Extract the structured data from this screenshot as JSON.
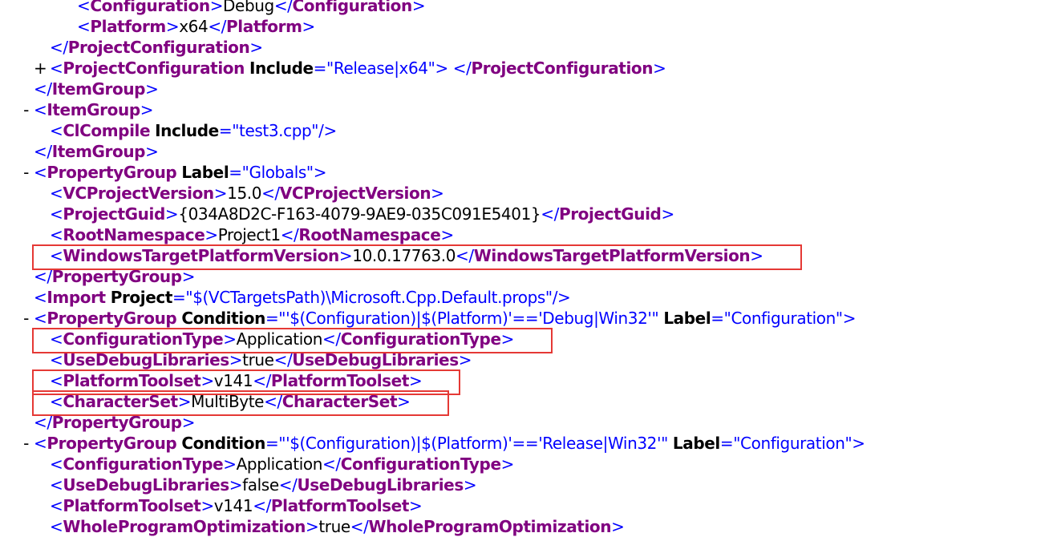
{
  "colors": {
    "tag": "#800080",
    "attr_name": "#000000",
    "attr_value": "#0000ff",
    "text": "#000000",
    "punct": "#0000ff",
    "highlight_border": "#e53935"
  },
  "lines": [
    {
      "toggle": "",
      "depth": 3,
      "tokens": [
        [
          "p",
          "<"
        ],
        [
          "t",
          "Configuration"
        ],
        [
          "p",
          ">"
        ],
        [
          "x",
          "Debug"
        ],
        [
          "p",
          "</"
        ],
        [
          "t",
          "Configuration"
        ],
        [
          "p",
          ">"
        ]
      ]
    },
    {
      "toggle": "",
      "depth": 3,
      "tokens": [
        [
          "p",
          "<"
        ],
        [
          "t",
          "Platform"
        ],
        [
          "p",
          ">"
        ],
        [
          "x",
          "x64"
        ],
        [
          "p",
          "</"
        ],
        [
          "t",
          "Platform"
        ],
        [
          "p",
          ">"
        ]
      ]
    },
    {
      "toggle": "",
      "depth": 2,
      "tokens": [
        [
          "p",
          "</"
        ],
        [
          "t",
          "ProjectConfiguration"
        ],
        [
          "p",
          ">"
        ]
      ]
    },
    {
      "toggle": "+",
      "depth": 2,
      "tokens": [
        [
          "p",
          "<"
        ],
        [
          "t",
          "ProjectConfiguration"
        ],
        [
          "x",
          " "
        ],
        [
          "n",
          "Include"
        ],
        [
          "p",
          "=\""
        ],
        [
          "v",
          "Release|x64"
        ],
        [
          "p",
          "\""
        ],
        [
          "p",
          ">"
        ],
        [
          "x",
          " "
        ],
        [
          "p",
          "</"
        ],
        [
          "t",
          "ProjectConfiguration"
        ],
        [
          "p",
          ">"
        ]
      ]
    },
    {
      "toggle": "",
      "depth": 1,
      "tokens": [
        [
          "p",
          "</"
        ],
        [
          "t",
          "ItemGroup"
        ],
        [
          "p",
          ">"
        ]
      ]
    },
    {
      "toggle": "-",
      "depth": 1,
      "tokens": [
        [
          "p",
          "<"
        ],
        [
          "t",
          "ItemGroup"
        ],
        [
          "p",
          ">"
        ]
      ]
    },
    {
      "toggle": "",
      "depth": 2,
      "tokens": [
        [
          "p",
          "<"
        ],
        [
          "t",
          "ClCompile"
        ],
        [
          "x",
          " "
        ],
        [
          "n",
          "Include"
        ],
        [
          "p",
          "=\""
        ],
        [
          "v",
          "test3.cpp"
        ],
        [
          "p",
          "\""
        ],
        [
          "p",
          "/>"
        ]
      ]
    },
    {
      "toggle": "",
      "depth": 1,
      "tokens": [
        [
          "p",
          "</"
        ],
        [
          "t",
          "ItemGroup"
        ],
        [
          "p",
          ">"
        ]
      ]
    },
    {
      "toggle": "-",
      "depth": 1,
      "tokens": [
        [
          "p",
          "<"
        ],
        [
          "t",
          "PropertyGroup"
        ],
        [
          "x",
          " "
        ],
        [
          "n",
          "Label"
        ],
        [
          "p",
          "=\""
        ],
        [
          "v",
          "Globals"
        ],
        [
          "p",
          "\""
        ],
        [
          "p",
          ">"
        ]
      ]
    },
    {
      "toggle": "",
      "depth": 2,
      "tokens": [
        [
          "p",
          "<"
        ],
        [
          "t",
          "VCProjectVersion"
        ],
        [
          "p",
          ">"
        ],
        [
          "x",
          "15.0"
        ],
        [
          "p",
          "</"
        ],
        [
          "t",
          "VCProjectVersion"
        ],
        [
          "p",
          ">"
        ]
      ]
    },
    {
      "toggle": "",
      "depth": 2,
      "tokens": [
        [
          "p",
          "<"
        ],
        [
          "t",
          "ProjectGuid"
        ],
        [
          "p",
          ">"
        ],
        [
          "x",
          "{034A8D2C-F163-4079-9AE9-035C091E5401}"
        ],
        [
          "p",
          "</"
        ],
        [
          "t",
          "ProjectGuid"
        ],
        [
          "p",
          ">"
        ]
      ]
    },
    {
      "toggle": "",
      "depth": 2,
      "tokens": [
        [
          "p",
          "<"
        ],
        [
          "t",
          "RootNamespace"
        ],
        [
          "p",
          ">"
        ],
        [
          "x",
          "Project1"
        ],
        [
          "p",
          "</"
        ],
        [
          "t",
          "RootNamespace"
        ],
        [
          "p",
          ">"
        ]
      ]
    },
    {
      "toggle": "",
      "depth": 2,
      "tokens": [
        [
          "p",
          "<"
        ],
        [
          "t",
          "WindowsTargetPlatformVersion"
        ],
        [
          "p",
          ">"
        ],
        [
          "x",
          "10.0.17763.0"
        ],
        [
          "p",
          "</"
        ],
        [
          "t",
          "WindowsTargetPlatformVersion"
        ],
        [
          "p",
          ">"
        ]
      ]
    },
    {
      "toggle": "",
      "depth": 1,
      "tokens": [
        [
          "p",
          "</"
        ],
        [
          "t",
          "PropertyGroup"
        ],
        [
          "p",
          ">"
        ]
      ]
    },
    {
      "toggle": "",
      "depth": 1,
      "tokens": [
        [
          "p",
          "<"
        ],
        [
          "t",
          "Import"
        ],
        [
          "x",
          " "
        ],
        [
          "n",
          "Project"
        ],
        [
          "p",
          "=\""
        ],
        [
          "v",
          "$(VCTargetsPath)\\Microsoft.Cpp.Default.props"
        ],
        [
          "p",
          "\""
        ],
        [
          "p",
          "/>"
        ]
      ]
    },
    {
      "toggle": "-",
      "depth": 1,
      "tokens": [
        [
          "p",
          "<"
        ],
        [
          "t",
          "PropertyGroup"
        ],
        [
          "x",
          " "
        ],
        [
          "n",
          "Condition"
        ],
        [
          "p",
          "=\""
        ],
        [
          "v",
          "'$(Configuration)|$(Platform)'=='Debug|Win32'"
        ],
        [
          "p",
          "\""
        ],
        [
          "x",
          " "
        ],
        [
          "n",
          "Label"
        ],
        [
          "p",
          "=\""
        ],
        [
          "v",
          "Configuration"
        ],
        [
          "p",
          "\""
        ],
        [
          "p",
          ">"
        ]
      ]
    },
    {
      "toggle": "",
      "depth": 2,
      "tokens": [
        [
          "p",
          "<"
        ],
        [
          "t",
          "ConfigurationType"
        ],
        [
          "p",
          ">"
        ],
        [
          "x",
          "Application"
        ],
        [
          "p",
          "</"
        ],
        [
          "t",
          "ConfigurationType"
        ],
        [
          "p",
          ">"
        ]
      ]
    },
    {
      "toggle": "",
      "depth": 2,
      "tokens": [
        [
          "p",
          "<"
        ],
        [
          "t",
          "UseDebugLibraries"
        ],
        [
          "p",
          ">"
        ],
        [
          "x",
          "true"
        ],
        [
          "p",
          "</"
        ],
        [
          "t",
          "UseDebugLibraries"
        ],
        [
          "p",
          ">"
        ]
      ]
    },
    {
      "toggle": "",
      "depth": 2,
      "tokens": [
        [
          "p",
          "<"
        ],
        [
          "t",
          "PlatformToolset"
        ],
        [
          "p",
          ">"
        ],
        [
          "x",
          "v141"
        ],
        [
          "p",
          "</"
        ],
        [
          "t",
          "PlatformToolset"
        ],
        [
          "p",
          ">"
        ]
      ]
    },
    {
      "toggle": "",
      "depth": 2,
      "tokens": [
        [
          "p",
          "<"
        ],
        [
          "t",
          "CharacterSet"
        ],
        [
          "p",
          ">"
        ],
        [
          "x",
          "MultiByte"
        ],
        [
          "p",
          "</"
        ],
        [
          "t",
          "CharacterSet"
        ],
        [
          "p",
          ">"
        ]
      ]
    },
    {
      "toggle": "",
      "depth": 1,
      "tokens": [
        [
          "p",
          "</"
        ],
        [
          "t",
          "PropertyGroup"
        ],
        [
          "p",
          ">"
        ]
      ]
    },
    {
      "toggle": "-",
      "depth": 1,
      "tokens": [
        [
          "p",
          "<"
        ],
        [
          "t",
          "PropertyGroup"
        ],
        [
          "x",
          " "
        ],
        [
          "n",
          "Condition"
        ],
        [
          "p",
          "=\""
        ],
        [
          "v",
          "'$(Configuration)|$(Platform)'=='Release|Win32'"
        ],
        [
          "p",
          "\""
        ],
        [
          "x",
          " "
        ],
        [
          "n",
          "Label"
        ],
        [
          "p",
          "=\""
        ],
        [
          "v",
          "Configuration"
        ],
        [
          "p",
          "\""
        ],
        [
          "p",
          ">"
        ]
      ]
    },
    {
      "toggle": "",
      "depth": 2,
      "tokens": [
        [
          "p",
          "<"
        ],
        [
          "t",
          "ConfigurationType"
        ],
        [
          "p",
          ">"
        ],
        [
          "x",
          "Application"
        ],
        [
          "p",
          "</"
        ],
        [
          "t",
          "ConfigurationType"
        ],
        [
          "p",
          ">"
        ]
      ]
    },
    {
      "toggle": "",
      "depth": 2,
      "tokens": [
        [
          "p",
          "<"
        ],
        [
          "t",
          "UseDebugLibraries"
        ],
        [
          "p",
          ">"
        ],
        [
          "x",
          "false"
        ],
        [
          "p",
          "</"
        ],
        [
          "t",
          "UseDebugLibraries"
        ],
        [
          "p",
          ">"
        ]
      ]
    },
    {
      "toggle": "",
      "depth": 2,
      "tokens": [
        [
          "p",
          "<"
        ],
        [
          "t",
          "PlatformToolset"
        ],
        [
          "p",
          ">"
        ],
        [
          "x",
          "v141"
        ],
        [
          "p",
          "</"
        ],
        [
          "t",
          "PlatformToolset"
        ],
        [
          "p",
          ">"
        ]
      ]
    },
    {
      "toggle": "",
      "depth": 2,
      "tokens": [
        [
          "p",
          "<"
        ],
        [
          "t",
          "WholeProgramOptimization"
        ],
        [
          "p",
          ">"
        ],
        [
          "x",
          "true"
        ],
        [
          "p",
          "</"
        ],
        [
          "t",
          "WholeProgramOptimization"
        ],
        [
          "p",
          ">"
        ]
      ]
    }
  ],
  "highlights": [
    12,
    16,
    18,
    19
  ]
}
